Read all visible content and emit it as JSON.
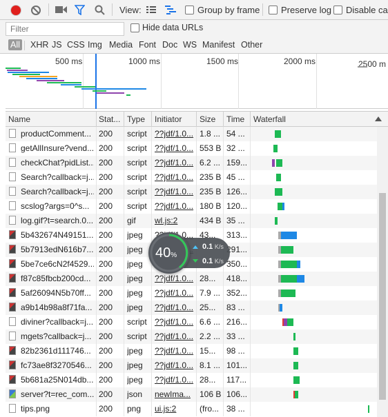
{
  "toolbar": {
    "view_label": "View:",
    "group_by_frame": "Group by frame",
    "preserve_log": "Preserve log",
    "disable_cache": "Disable cac"
  },
  "filter": {
    "placeholder": "Filter",
    "hide_data_urls": "Hide data URLs",
    "types": [
      "All",
      "XHR",
      "JS",
      "CSS",
      "Img",
      "Media",
      "Font",
      "Doc",
      "WS",
      "Manifest",
      "Other"
    ]
  },
  "overview": {
    "ticks": [
      "500 ms",
      "1000 ms",
      "1500 ms",
      "2000 ms",
      "2500 m"
    ]
  },
  "columns": [
    "Name",
    "Stat...",
    "Type",
    "Initiator",
    "Size",
    "Time",
    "Waterfall"
  ],
  "rows": [
    {
      "name": "productComment...",
      "status": "200",
      "type": "script",
      "initiator": "??jdf/1.0...",
      "size": "1.8 ...",
      "time": "54 ...",
      "icon": "doc"
    },
    {
      "name": "getAllInsure?vend...",
      "status": "200",
      "type": "script",
      "initiator": "??jdf/1.0...",
      "size": "553 B",
      "time": "32 ...",
      "icon": "doc"
    },
    {
      "name": "checkChat?pidList...",
      "status": "200",
      "type": "script",
      "initiator": "??jdf/1.0...",
      "size": "6.2 ...",
      "time": "159...",
      "icon": "doc"
    },
    {
      "name": "Search?callback=j...",
      "status": "200",
      "type": "script",
      "initiator": "??jdf/1.0...",
      "size": "235 B",
      "time": "45 ...",
      "icon": "doc"
    },
    {
      "name": "Search?callback=j...",
      "status": "200",
      "type": "script",
      "initiator": "??jdf/1.0...",
      "size": "235 B",
      "time": "126...",
      "icon": "doc"
    },
    {
      "name": "scslog?args=0^s...",
      "status": "200",
      "type": "script",
      "initiator": "??jdf/1.0...",
      "size": "180 B",
      "time": "120...",
      "icon": "doc"
    },
    {
      "name": "log.gif?t=search.0...",
      "status": "200",
      "type": "gif",
      "initiator": "wl.js:2",
      "size": "434 B",
      "time": "35 ...",
      "icon": "blank"
    },
    {
      "name": "5b432674N49151...",
      "status": "200",
      "type": "jpeg",
      "initiator": "??jdf/1.0...",
      "size": "43...",
      "time": "313...",
      "icon": "img"
    },
    {
      "name": "5b7913edN616b7...",
      "status": "200",
      "type": "jpeg",
      "initiator": "??jdf/1.0...",
      "size": "",
      "time": "291...",
      "icon": "img"
    },
    {
      "name": "5be7ce6cN2f4529...",
      "status": "200",
      "type": "jpeg",
      "initiator": "",
      "size": "",
      "time": "350...",
      "icon": "img"
    },
    {
      "name": "f87c85fbcb200cd...",
      "status": "200",
      "type": "jpeg",
      "initiator": "??jdf/1.0...",
      "size": "28...",
      "time": "418...",
      "icon": "img"
    },
    {
      "name": "5af26094N5b70ff...",
      "status": "200",
      "type": "jpeg",
      "initiator": "??jdf/1.0...",
      "size": "7.9 ...",
      "time": "352...",
      "icon": "img"
    },
    {
      "name": "a9b14b98a8f71fa...",
      "status": "200",
      "type": "jpeg",
      "initiator": "??jdf/1.0...",
      "size": "25...",
      "time": "83 ...",
      "icon": "img"
    },
    {
      "name": "diviner?callback=j...",
      "status": "200",
      "type": "script",
      "initiator": "??jdf/1.0...",
      "size": "6.6 ...",
      "time": "216...",
      "icon": "doc"
    },
    {
      "name": "mgets?callback=j...",
      "status": "200",
      "type": "script",
      "initiator": "??jdf/1.0...",
      "size": "2.2 ...",
      "time": "33 ...",
      "icon": "doc"
    },
    {
      "name": "82b2361d111746...",
      "status": "200",
      "type": "jpeg",
      "initiator": "??jdf/1.0...",
      "size": "15...",
      "time": "98 ...",
      "icon": "img"
    },
    {
      "name": "fc73ae8f3270546...",
      "status": "200",
      "type": "jpeg",
      "initiator": "??jdf/1.0...",
      "size": "8.1 ...",
      "time": "101...",
      "icon": "img"
    },
    {
      "name": "5b681a25N014db...",
      "status": "200",
      "type": "jpeg",
      "initiator": "??jdf/1.0...",
      "size": "28...",
      "time": "117...",
      "icon": "img"
    },
    {
      "name": "server?t=rec_com...",
      "status": "200",
      "type": "json",
      "initiator": "newIma...",
      "size": "106 B",
      "time": "106...",
      "icon": "imgblue"
    },
    {
      "name": "tips.png",
      "status": "200",
      "type": "png",
      "initiator": "ui.js:2",
      "size": "(fro...",
      "time": "38 ...",
      "icon": "blank"
    }
  ],
  "waterfall_bars": [
    [
      {
        "c": "#1db954",
        "a": 0.18,
        "w": 0.05
      }
    ],
    [
      {
        "c": "#1db954",
        "a": 0.17,
        "w": 0.03
      }
    ],
    [
      {
        "c": "#8e44ad",
        "a": 0.16,
        "w": 0.02
      },
      {
        "c": "#1db954",
        "a": 0.19,
        "w": 0.05
      }
    ],
    [
      {
        "c": "#1db954",
        "a": 0.19,
        "w": 0.04
      }
    ],
    [
      {
        "c": "#1db954",
        "a": 0.18,
        "w": 0.06
      }
    ],
    [
      {
        "c": "#1db954",
        "a": 0.2,
        "w": 0.05
      },
      {
        "c": "#1e88e5",
        "a": 0.24,
        "w": 0.02
      }
    ],
    [
      {
        "c": "#1db954",
        "a": 0.18,
        "w": 0.02
      }
    ],
    [
      {
        "c": "#aaaaaa",
        "a": 0.21,
        "w": 0.02
      },
      {
        "c": "#1e88e5",
        "a": 0.23,
        "w": 0.13
      }
    ],
    [
      {
        "c": "#aaaaaa",
        "a": 0.21,
        "w": 0.02
      },
      {
        "c": "#1db954",
        "a": 0.23,
        "w": 0.1
      }
    ],
    [
      {
        "c": "#aaaaaa",
        "a": 0.21,
        "w": 0.02
      },
      {
        "c": "#1db954",
        "a": 0.23,
        "w": 0.13
      },
      {
        "c": "#1e88e5",
        "a": 0.36,
        "w": 0.03
      }
    ],
    [
      {
        "c": "#aaaaaa",
        "a": 0.21,
        "w": 0.02
      },
      {
        "c": "#1db954",
        "a": 0.23,
        "w": 0.13
      },
      {
        "c": "#1e88e5",
        "a": 0.36,
        "w": 0.06
      }
    ],
    [
      {
        "c": "#aaaaaa",
        "a": 0.21,
        "w": 0.02
      },
      {
        "c": "#1db954",
        "a": 0.23,
        "w": 0.12
      }
    ],
    [
      {
        "c": "#aaaaaa",
        "a": 0.21,
        "w": 0.01
      },
      {
        "c": "#1e88e5",
        "a": 0.22,
        "w": 0.02
      }
    ],
    [
      {
        "c": "#e53935",
        "a": 0.24,
        "w": 0.01
      },
      {
        "c": "#8e44ad",
        "a": 0.25,
        "w": 0.03
      },
      {
        "c": "#1db954",
        "a": 0.28,
        "w": 0.05
      }
    ],
    [
      {
        "c": "#1db954",
        "a": 0.33,
        "w": 0.02
      }
    ],
    [
      {
        "c": "#1db954",
        "a": 0.33,
        "w": 0.04
      }
    ],
    [
      {
        "c": "#1db954",
        "a": 0.33,
        "w": 0.04
      }
    ],
    [
      {
        "c": "#1db954",
        "a": 0.33,
        "w": 0.05
      }
    ],
    [
      {
        "c": "#e53935",
        "a": 0.33,
        "w": 0.01
      },
      {
        "c": "#1db954",
        "a": 0.34,
        "w": 0.03
      }
    ],
    [
      {
        "c": "#1db954",
        "a": 0.94,
        "w": 0.01
      }
    ]
  ],
  "speed_widget": {
    "percent": "40",
    "percent_unit": "%",
    "up": "0.1",
    "down": "0.1",
    "unit": "K/s"
  },
  "colors": {
    "accent": "#1a73e8",
    "record": "#e0201d",
    "green": "#1db954",
    "blue": "#1e88e5"
  }
}
